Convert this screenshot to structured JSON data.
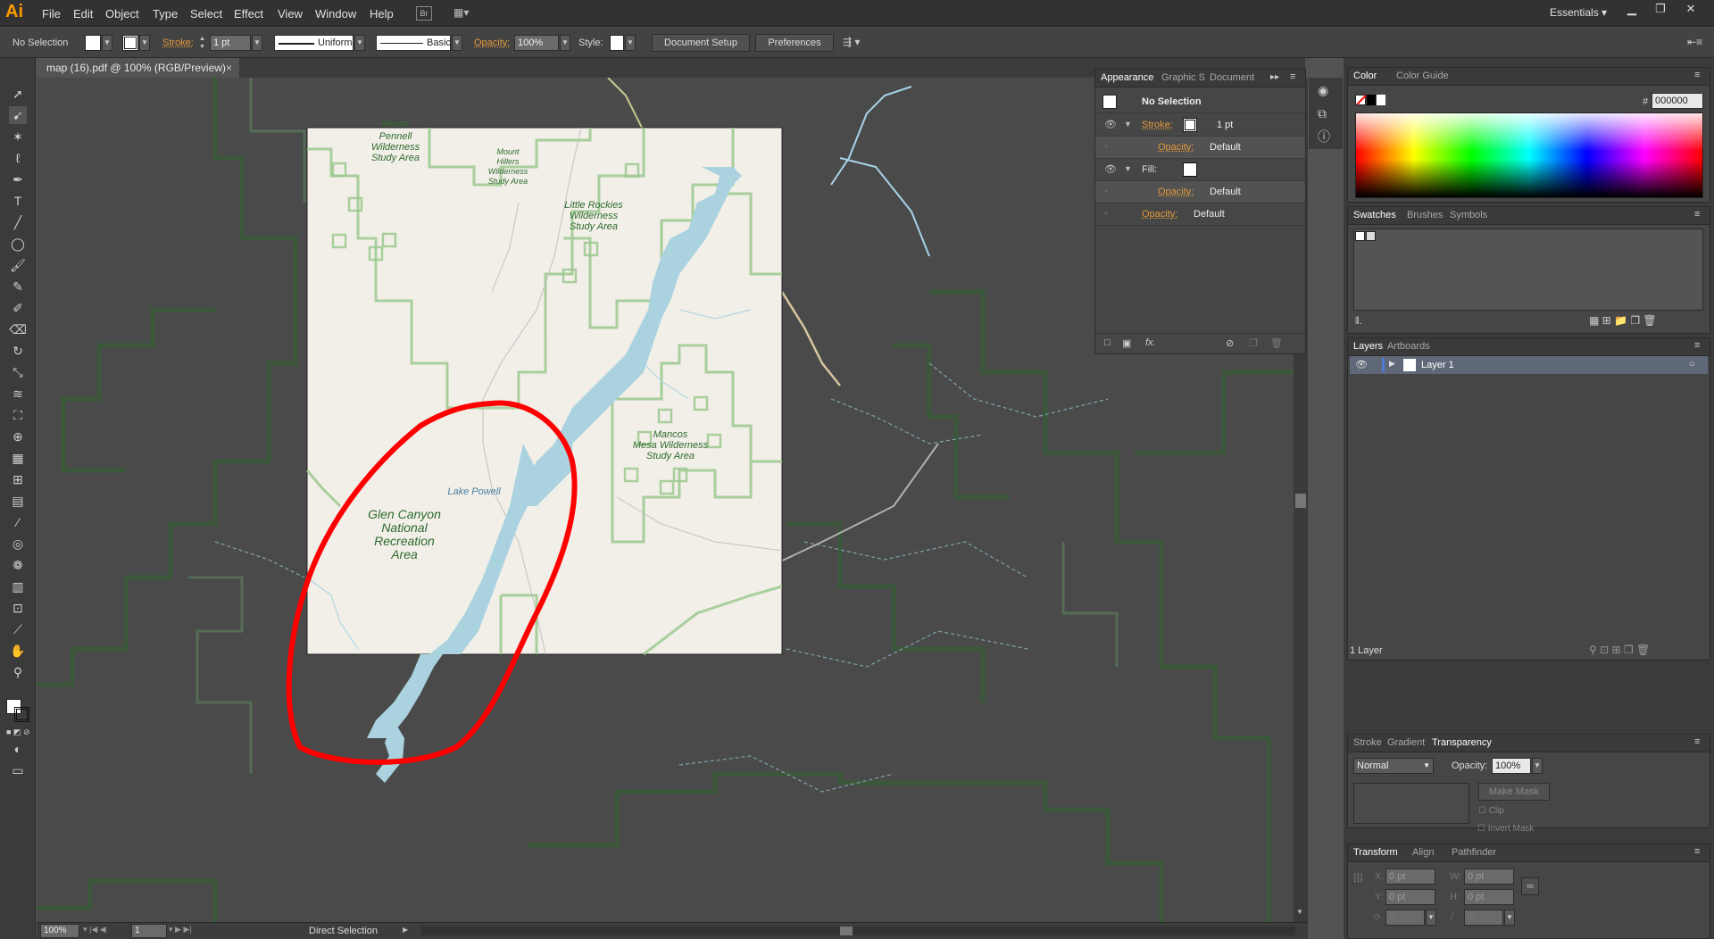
{
  "app": {
    "logo": "Ai",
    "workspace": "Essentials"
  },
  "menu": [
    "File",
    "Edit",
    "Object",
    "Type",
    "Select",
    "Effect",
    "View",
    "Window",
    "Help"
  ],
  "control_bar": {
    "selection": "No Selection",
    "stroke_label": "Stroke:",
    "stroke_weight": "1 pt",
    "stroke_profile": "Uniform",
    "brush": "Basic",
    "opacity_label": "Opacity:",
    "opacity": "100%",
    "style_label": "Style:",
    "document_setup": "Document Setup",
    "preferences": "Preferences"
  },
  "document_tab": {
    "title": "map (16).pdf @ 100% (RGB/Preview)",
    "close": "×"
  },
  "map": {
    "labels": {
      "mount_top": "Mount",
      "pennell": [
        "Pennell",
        "Wilderness",
        "Study Area"
      ],
      "hillers": [
        "Mount",
        "Hillers",
        "Wilderness",
        "Study Area"
      ],
      "little_rockies": [
        "Little Rockies",
        "Wilderness",
        "Study Area"
      ],
      "mancos": [
        "Mancos",
        "Mesa Wilderness",
        "Study Area"
      ],
      "lake_powell": "Lake Powell",
      "glen_canyon": [
        "Glen Canyon",
        "National",
        "Recreation",
        "Area"
      ]
    },
    "colors": {
      "paper": "#f2efe9",
      "water": "#aad3df",
      "boundary": "#9cc98f",
      "annotation": "#ff0000"
    }
  },
  "status_bar": {
    "zoom": "100%",
    "artboard": "1",
    "tool": "Direct Selection"
  },
  "appearance_panel": {
    "tabs": [
      "Appearance",
      "Graphic S",
      "Document"
    ],
    "title": "No Selection",
    "stroke_label": "Stroke:",
    "stroke_value": "1 pt",
    "opacity_label": "Opacity:",
    "opacity_value": "Default",
    "fill_label": "Fill:",
    "fx": "fx."
  },
  "color_panel": {
    "tabs": [
      "Color",
      "Color Guide"
    ],
    "hex_label": "#",
    "hex": "000000"
  },
  "swatches_panel": {
    "tabs": [
      "Swatches",
      "Brushes",
      "Symbols"
    ]
  },
  "layers_panel": {
    "tabs": [
      "Layers",
      "Artboards"
    ],
    "layer_name": "Layer 1",
    "footer": "1 Layer"
  },
  "transparency_panel": {
    "tabs": [
      "Stroke",
      "Gradient",
      "Transparency"
    ],
    "blend_mode": "Normal",
    "opacity_label": "Opacity:",
    "opacity": "100%",
    "make_mask": "Make Mask",
    "clip": "Clip",
    "invert_mask": "Invert Mask"
  },
  "transform_panel": {
    "tabs": [
      "Transform",
      "Align",
      "Pathfinder"
    ],
    "x_label": "X:",
    "x": "0 pt",
    "y_label": "Y:",
    "y": "0 pt",
    "w_label": "W:",
    "w": "0 pt",
    "h_label": "H:",
    "h": "0 pt",
    "angle": "0°",
    "shear": "0°"
  }
}
